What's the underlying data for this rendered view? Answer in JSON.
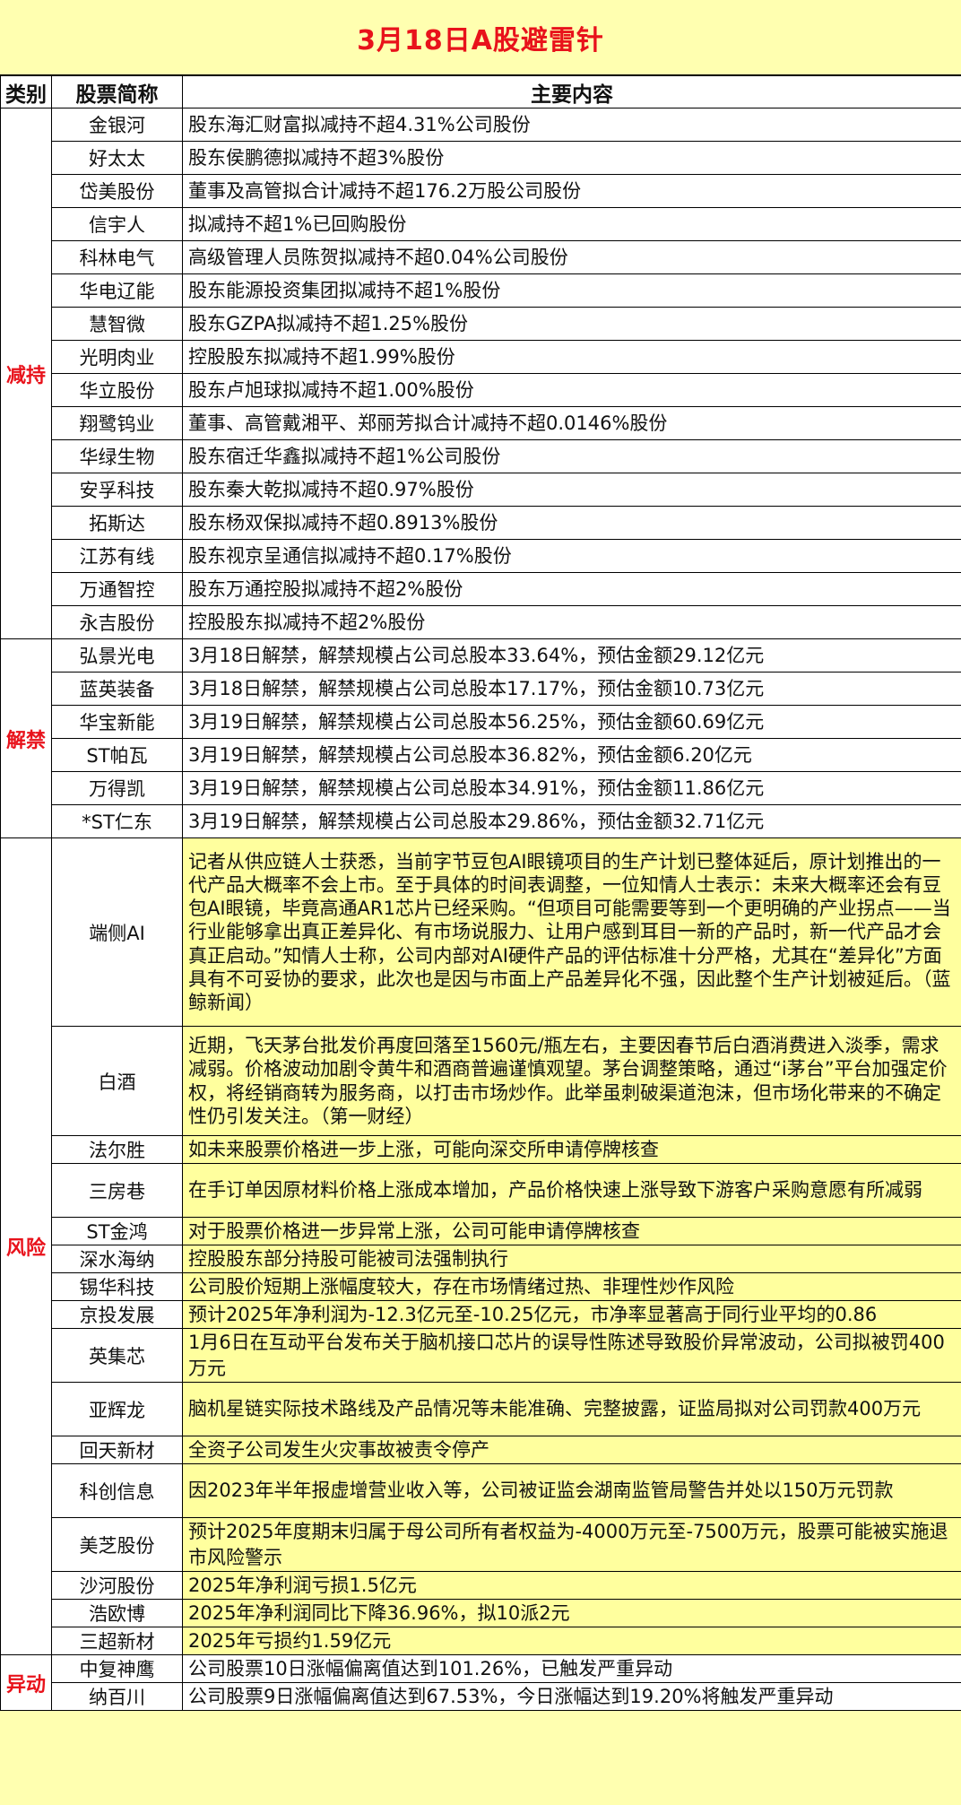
{
  "title": "3月18日A股避雷针",
  "header": {
    "category": "类别",
    "name": "股票简称",
    "content": "主要内容"
  },
  "sections": {
    "reduce": {
      "label": "减持",
      "rows": [
        {
          "name": "金银河",
          "content": "股东海汇财富拟减持不超4.31%公司股份"
        },
        {
          "name": "好太太",
          "content": "股东侯鹏德拟减持不超3%股份"
        },
        {
          "name": "岱美股份",
          "content": "董事及高管拟合计减持不超176.2万股公司股份"
        },
        {
          "name": "信宇人",
          "content": "拟减持不超1%已回购股份"
        },
        {
          "name": "科林电气",
          "content": "高级管理人员陈贺拟减持不超0.04%公司股份"
        },
        {
          "name": "华电辽能",
          "content": "股东能源投资集团拟减持不超1%股份"
        },
        {
          "name": "慧智微",
          "content": "股东GZPA拟减持不超1.25%股份"
        },
        {
          "name": "光明肉业",
          "content": "控股股东拟减持不超1.99%股份"
        },
        {
          "name": "华立股份",
          "content": "股东卢旭球拟减持不超1.00%股份"
        },
        {
          "name": "翔鹭钨业",
          "content": "董事、高管戴湘平、郑丽芳拟合计减持不超0.0146%股份"
        },
        {
          "name": "华绿生物",
          "content": "股东宿迁华鑫拟减持不超1%公司股份"
        },
        {
          "name": "安孚科技",
          "content": "股东秦大乾拟减持不超0.97%股份"
        },
        {
          "name": "拓斯达",
          "content": "股东杨双保拟减持不超0.8913%股份"
        },
        {
          "name": "江苏有线",
          "content": "股东视京呈通信拟减持不超0.17%股份"
        },
        {
          "name": "万通智控",
          "content": "股东万通控股拟减持不超2%股份"
        },
        {
          "name": "永吉股份",
          "content": "控股股东拟减持不超2%股份"
        }
      ]
    },
    "unlock": {
      "label": "解禁",
      "rows": [
        {
          "name": "弘景光电",
          "content": "3月18日解禁，解禁规模占公司总股本33.64%，预估金额29.12亿元"
        },
        {
          "name": "蓝英装备",
          "content": "3月18日解禁，解禁规模占公司总股本17.17%，预估金额10.73亿元"
        },
        {
          "name": "华宝新能",
          "content": "3月19日解禁，解禁规模占公司总股本56.25%，预估金额60.69亿元"
        },
        {
          "name": "ST帕瓦",
          "content": "3月19日解禁，解禁规模占公司总股本36.82%，预估金额6.20亿元"
        },
        {
          "name": "万得凯",
          "content": "3月19日解禁，解禁规模占公司总股本34.91%，预估金额11.86亿元"
        },
        {
          "name": "*ST仁东",
          "content": "3月19日解禁，解禁规模占公司总股本29.86%，预估金额32.71亿元"
        }
      ]
    },
    "risk": {
      "label": "风险",
      "rows": [
        {
          "name": "端侧AI",
          "content": "记者从供应链人士获悉，当前字节豆包AI眼镜项目的生产计划已整体延后，原计划推出的一代产品大概率不会上市。至于具体的时间表调整，一位知情人士表示：未来大概率还会有豆包AI眼镜，毕竟高通AR1芯片已经采购。“但项目可能需要等到一个更明确的产业拐点——当行业能够拿出真正差异化、有市场说服力、让用户感到耳目一新的产品时，新一代产品才会真正启动。”知情人士称，公司内部对AI硬件产品的评估标准十分严格，尤其在“差异化”方面具有不可妥协的要求，此次也是因与市面上产品差异化不强，因此整个生产计划被延后。（蓝鲸新闻）"
        },
        {
          "name": "白酒",
          "content": "近期，飞天茅台批发价再度回落至1560元/瓶左右，主要因春节后白酒消费进入淡季，需求减弱。价格波动加剧令黄牛和酒商普遍谨慎观望。茅台调整策略，通过“i茅台”平台加强定价权，将经销商转为服务商，以打击市场炒作。此举虽刺破渠道泡沫，但市场化带来的不确定性仍引发关注。（第一财经）"
        },
        {
          "name": "法尔胜",
          "content": "如未来股票价格进一步上涨，可能向深交所申请停牌核查"
        },
        {
          "name": "三房巷",
          "content": "在手订单因原材料价格上涨成本增加，产品价格快速上涨导致下游客户采购意愿有所减弱"
        },
        {
          "name": "ST金鸿",
          "content": "对于股票价格进一步异常上涨，公司可能申请停牌核查"
        },
        {
          "name": "深水海纳",
          "content": "控股股东部分持股可能被司法强制执行"
        },
        {
          "name": "锡华科技",
          "content": "公司股价短期上涨幅度较大，存在市场情绪过热、非理性炒作风险"
        },
        {
          "name": "京投发展",
          "content": "预计2025年净利润为-12.3亿元至-10.25亿元，市净率显著高于同行业平均的0.86"
        },
        {
          "name": "英集芯",
          "content": "1月6日在互动平台发布关于脑机接口芯片的误导性陈述导致股价异常波动，公司拟被罚400万元"
        },
        {
          "name": "亚辉龙",
          "content": "脑机星链实际技术路线及产品情况等未能准确、完整披露，证监局拟对公司罚款400万元"
        },
        {
          "name": "回天新材",
          "content": "全资子公司发生火灾事故被责令停产"
        },
        {
          "name": "科创信息",
          "content": "因2023年半年报虚增营业收入等，公司被证监会湖南监管局警告并处以150万元罚款"
        },
        {
          "name": "美芝股份",
          "content": "预计2025年度期末归属于母公司所有者权益为-4000万元至-7500万元，股票可能被实施退市风险警示"
        },
        {
          "name": "沙河股份",
          "content": "2025年净利润亏损1.5亿元"
        },
        {
          "name": "浩欧博",
          "content": "2025年净利润同比下降36.96%，拟10派2元"
        },
        {
          "name": "三超新材",
          "content": "2025年亏损约1.59亿元"
        }
      ]
    },
    "abnormal": {
      "label": "异动",
      "rows": [
        {
          "name": "中复神鹰",
          "content": "公司股票10日涨幅偏离值达到101.26%，已触发严重异动"
        },
        {
          "name": "纳百川",
          "content": "公司股票9日涨幅偏离值达到67.53%，今日涨幅达到19.20%将触发严重异动"
        }
      ]
    }
  },
  "colors": {
    "title": "#E8121B",
    "category": "#E8121B",
    "highlight": "#FFFF9E",
    "page": "#FFFFB0"
  }
}
